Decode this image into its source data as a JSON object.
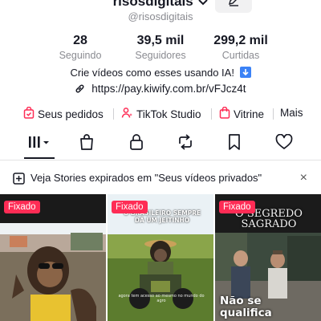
{
  "profile": {
    "username": "risosdigitais",
    "handle": "@risosdigitais"
  },
  "stats": [
    {
      "value": "28",
      "label": "Seguindo"
    },
    {
      "value": "39,5 mil",
      "label": "Seguidores"
    },
    {
      "value": "299,2 mil",
      "label": "Curtidas"
    }
  ],
  "bio": {
    "text": "Crie vídeos como esses usando IA!",
    "link": "https://pay.kiwify.com.br/vFJcz4t"
  },
  "shortcuts": {
    "orders": "Seus pedidos",
    "studio": "TikTok Studio",
    "showcase": "Vitrine",
    "more": "Mais"
  },
  "stories_banner": {
    "text": "Veja Stories expirados em \"Seus vídeos privados\"",
    "close": "×"
  },
  "videos": [
    {
      "pinned": "Fixado"
    },
    {
      "pinned": "Fixado",
      "caption": "O BRASILEIRO SEMPRE DÁ UM JEITINHO",
      "subtitle": "agora tem acesso ao mesmo no mundo do agro"
    },
    {
      "pinned": "Fixado",
      "title": "O SEGREDO SAGRADO",
      "caption": "Não se qualifica"
    }
  ],
  "colors": {
    "accent": "#fe2c55",
    "text": "#161823",
    "muted": "#8a8b91"
  }
}
